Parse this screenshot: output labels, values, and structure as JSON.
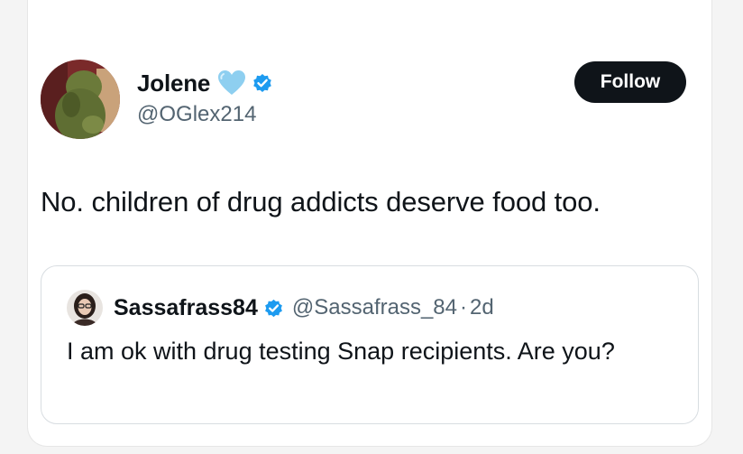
{
  "tweet": {
    "author": {
      "display_name": "Jolene",
      "handle": "@OGlex214",
      "avatar": "avatar-photo",
      "emoji_icon": "light-blue-heart-icon",
      "verified_icon": "verified-badge-icon",
      "verified_color": "#1d9bf0"
    },
    "follow_label": "Follow",
    "text": "No. children of drug addicts deserve food too.",
    "quoted": {
      "display_name": "Sassafrass84",
      "handle": "@Sassafrass_84",
      "separator": "·",
      "time": "2d",
      "text": "I am ok with drug testing Snap recipients. Are you?",
      "verified_icon": "verified-badge-icon",
      "avatar": "avatar-photo"
    }
  },
  "colors": {
    "text_primary": "#0f1419",
    "text_secondary": "#536471",
    "follow_button_bg": "#0f1419",
    "follow_button_text": "#ffffff",
    "heart": "#8ecff0",
    "verified": "#1d9bf0"
  }
}
